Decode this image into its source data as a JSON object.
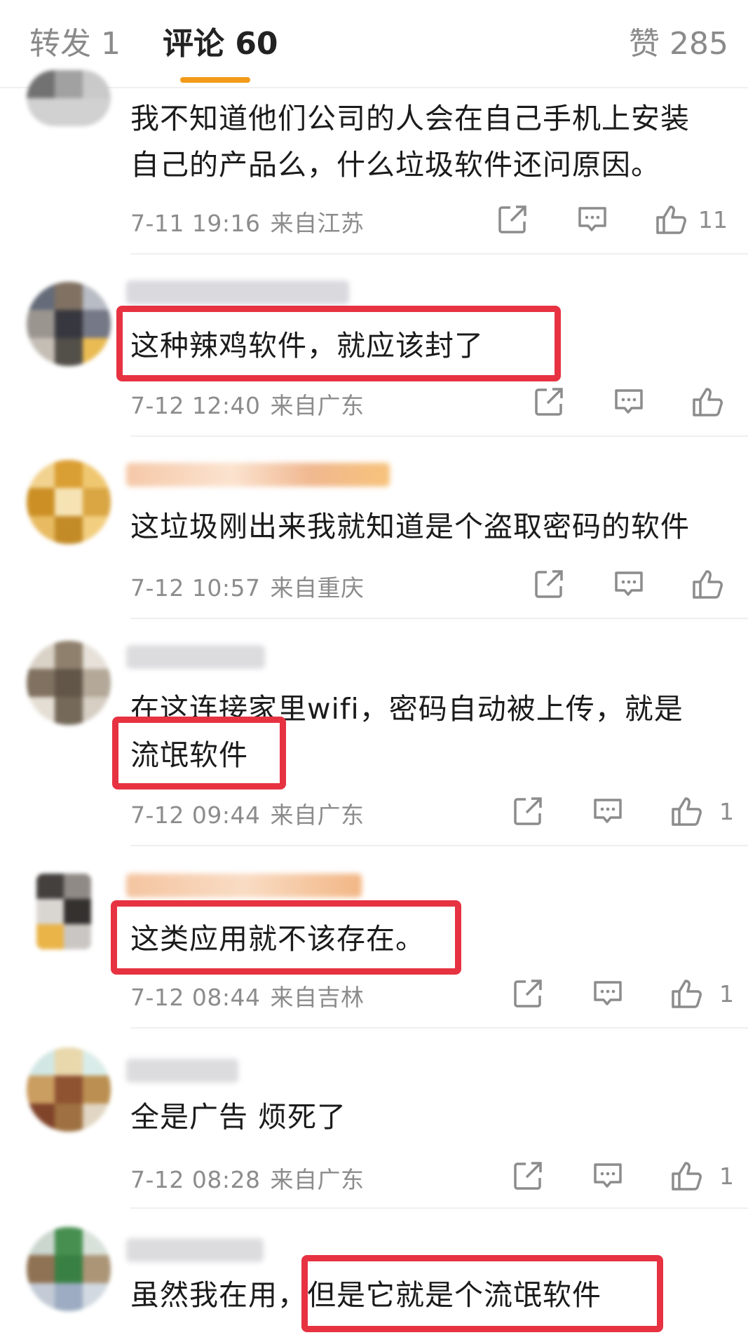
{
  "tabs": {
    "repost": "转发 1",
    "comments": "评论 60",
    "likes": "赞 285"
  },
  "icons": {
    "share": "share-icon",
    "reply": "comment-icon",
    "like": "thumbs-up-icon"
  },
  "accent_color": "#f29a1a",
  "highlight_color": "#e63241",
  "comments": [
    {
      "text_lines": [
        "我不知道他们公司的人会在自己手机上安装",
        "自己的产品么，什么垃圾软件还问原因。"
      ],
      "time": "7-11 19:16",
      "location": "来自江苏",
      "likes": "11"
    },
    {
      "text_lines": [
        "这种辣鸡软件，就应该封了"
      ],
      "time": "7-12 12:40",
      "location": "来自广东",
      "likes": ""
    },
    {
      "text_lines": [
        "这垃圾刚出来我就知道是个盗取密码的软件"
      ],
      "time": "7-12 10:57",
      "location": "来自重庆",
      "likes": ""
    },
    {
      "text_lines": [
        "在这连接家里wifi，密码自动被上传，就是",
        "流氓软件"
      ],
      "time": "7-12 09:44",
      "location": "来自广东",
      "likes": "1"
    },
    {
      "text_lines": [
        "这类应用就不该存在。"
      ],
      "time": "7-12 08:44",
      "location": "来自吉林",
      "likes": "1"
    },
    {
      "text_lines": [
        "全是广告 烦死了"
      ],
      "time": "7-12 08:28",
      "location": "来自广东",
      "likes": "1"
    },
    {
      "text_lines": [
        "虽然我在用，但是它就是个流氓软件"
      ]
    }
  ]
}
